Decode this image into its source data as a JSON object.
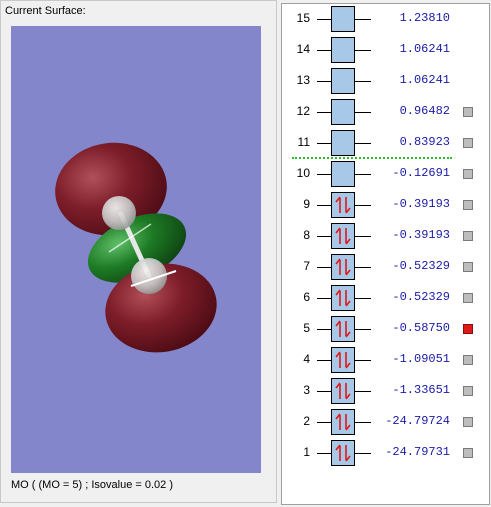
{
  "surface_panel": {
    "title": "Current Surface:",
    "status": "MO ( (MO = 5) ; Isovalue = 0.02 )",
    "background_color": "#8486cc"
  },
  "orbitals": [
    {
      "index": "15",
      "energy": "1.23810",
      "occupied": false,
      "has_checkbox": false,
      "checked": false
    },
    {
      "index": "14",
      "energy": "1.06241",
      "occupied": false,
      "has_checkbox": false,
      "checked": false
    },
    {
      "index": "13",
      "energy": "1.06241",
      "occupied": false,
      "has_checkbox": false,
      "checked": false
    },
    {
      "index": "12",
      "energy": "0.96482",
      "occupied": false,
      "has_checkbox": true,
      "checked": false
    },
    {
      "index": "11",
      "energy": "0.83923",
      "occupied": false,
      "has_checkbox": true,
      "checked": false
    },
    {
      "index": "10",
      "energy": "-0.12691",
      "occupied": false,
      "has_checkbox": true,
      "checked": false
    },
    {
      "index": "9",
      "energy": "-0.39193",
      "occupied": true,
      "has_checkbox": true,
      "checked": false
    },
    {
      "index": "8",
      "energy": "-0.39193",
      "occupied": true,
      "has_checkbox": true,
      "checked": false
    },
    {
      "index": "7",
      "energy": "-0.52329",
      "occupied": true,
      "has_checkbox": true,
      "checked": false
    },
    {
      "index": "6",
      "energy": "-0.52329",
      "occupied": true,
      "has_checkbox": true,
      "checked": false
    },
    {
      "index": "5",
      "energy": "-0.58750",
      "occupied": true,
      "has_checkbox": true,
      "checked": true
    },
    {
      "index": "4",
      "energy": "-1.09051",
      "occupied": true,
      "has_checkbox": true,
      "checked": false
    },
    {
      "index": "3",
      "energy": "-1.33651",
      "occupied": true,
      "has_checkbox": true,
      "checked": false
    },
    {
      "index": "2",
      "energy": "-24.79724",
      "occupied": true,
      "has_checkbox": true,
      "checked": false
    },
    {
      "index": "1",
      "energy": "-24.79731",
      "occupied": true,
      "has_checkbox": true,
      "checked": false
    }
  ],
  "colors": {
    "orbital_box": "#a8c8e8",
    "electron_arrows": "#e01818",
    "energy_text": "#1a1aa8",
    "selected_checkbox": "#e01818",
    "homo_lumo_divider": "#22c022"
  }
}
